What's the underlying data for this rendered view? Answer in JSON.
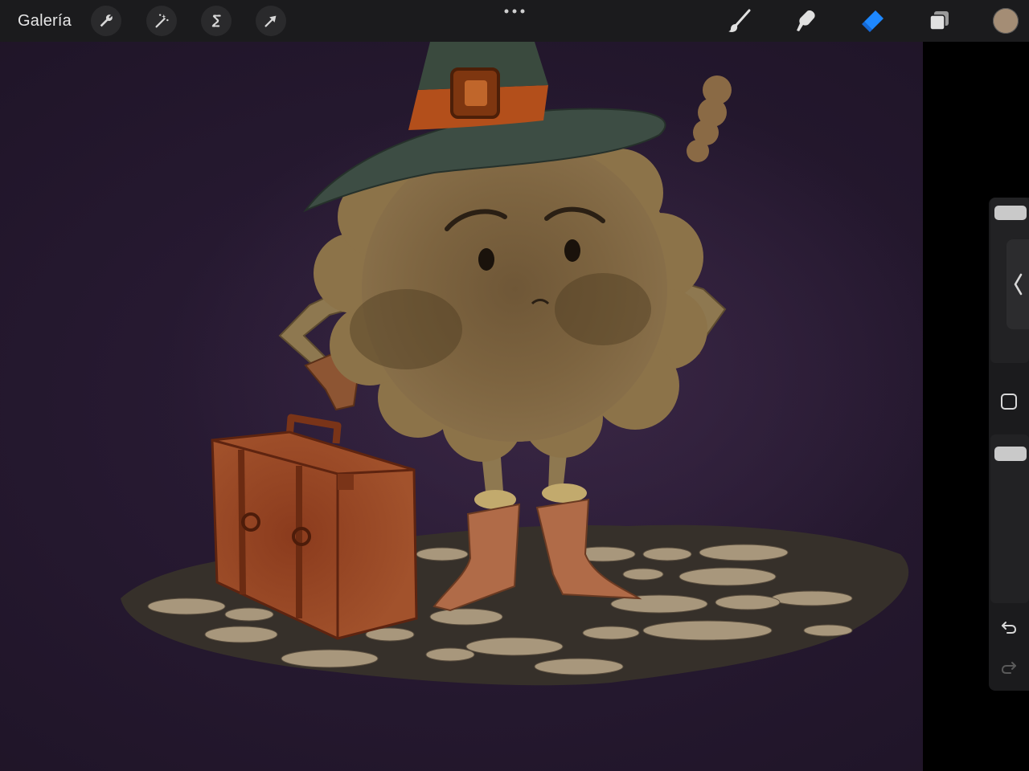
{
  "toolbar": {
    "gallery_label": "Galería",
    "left_tools": [
      {
        "icon": "wrench-icon",
        "name": "actions"
      },
      {
        "icon": "magic-wand-icon",
        "name": "adjustments"
      },
      {
        "icon": "selection-s-icon",
        "name": "selection"
      },
      {
        "icon": "arrow-cursor-icon",
        "name": "transform"
      }
    ],
    "more_icon": "ellipsis-icon",
    "right_tools": [
      {
        "icon": "brush-icon",
        "name": "paint"
      },
      {
        "icon": "smudge-icon",
        "name": "smudge"
      },
      {
        "icon": "eraser-icon",
        "name": "erase",
        "active": true
      },
      {
        "icon": "layers-icon",
        "name": "layers"
      }
    ],
    "current_color": "#a48d75",
    "active_color": "#1e88ff"
  },
  "sidebar": {
    "brush_size_level": 0.02,
    "opacity_level": 0.05,
    "icons": [
      "chevron-left-icon",
      "modify-square-icon",
      "undo-icon",
      "redo-icon"
    ]
  }
}
